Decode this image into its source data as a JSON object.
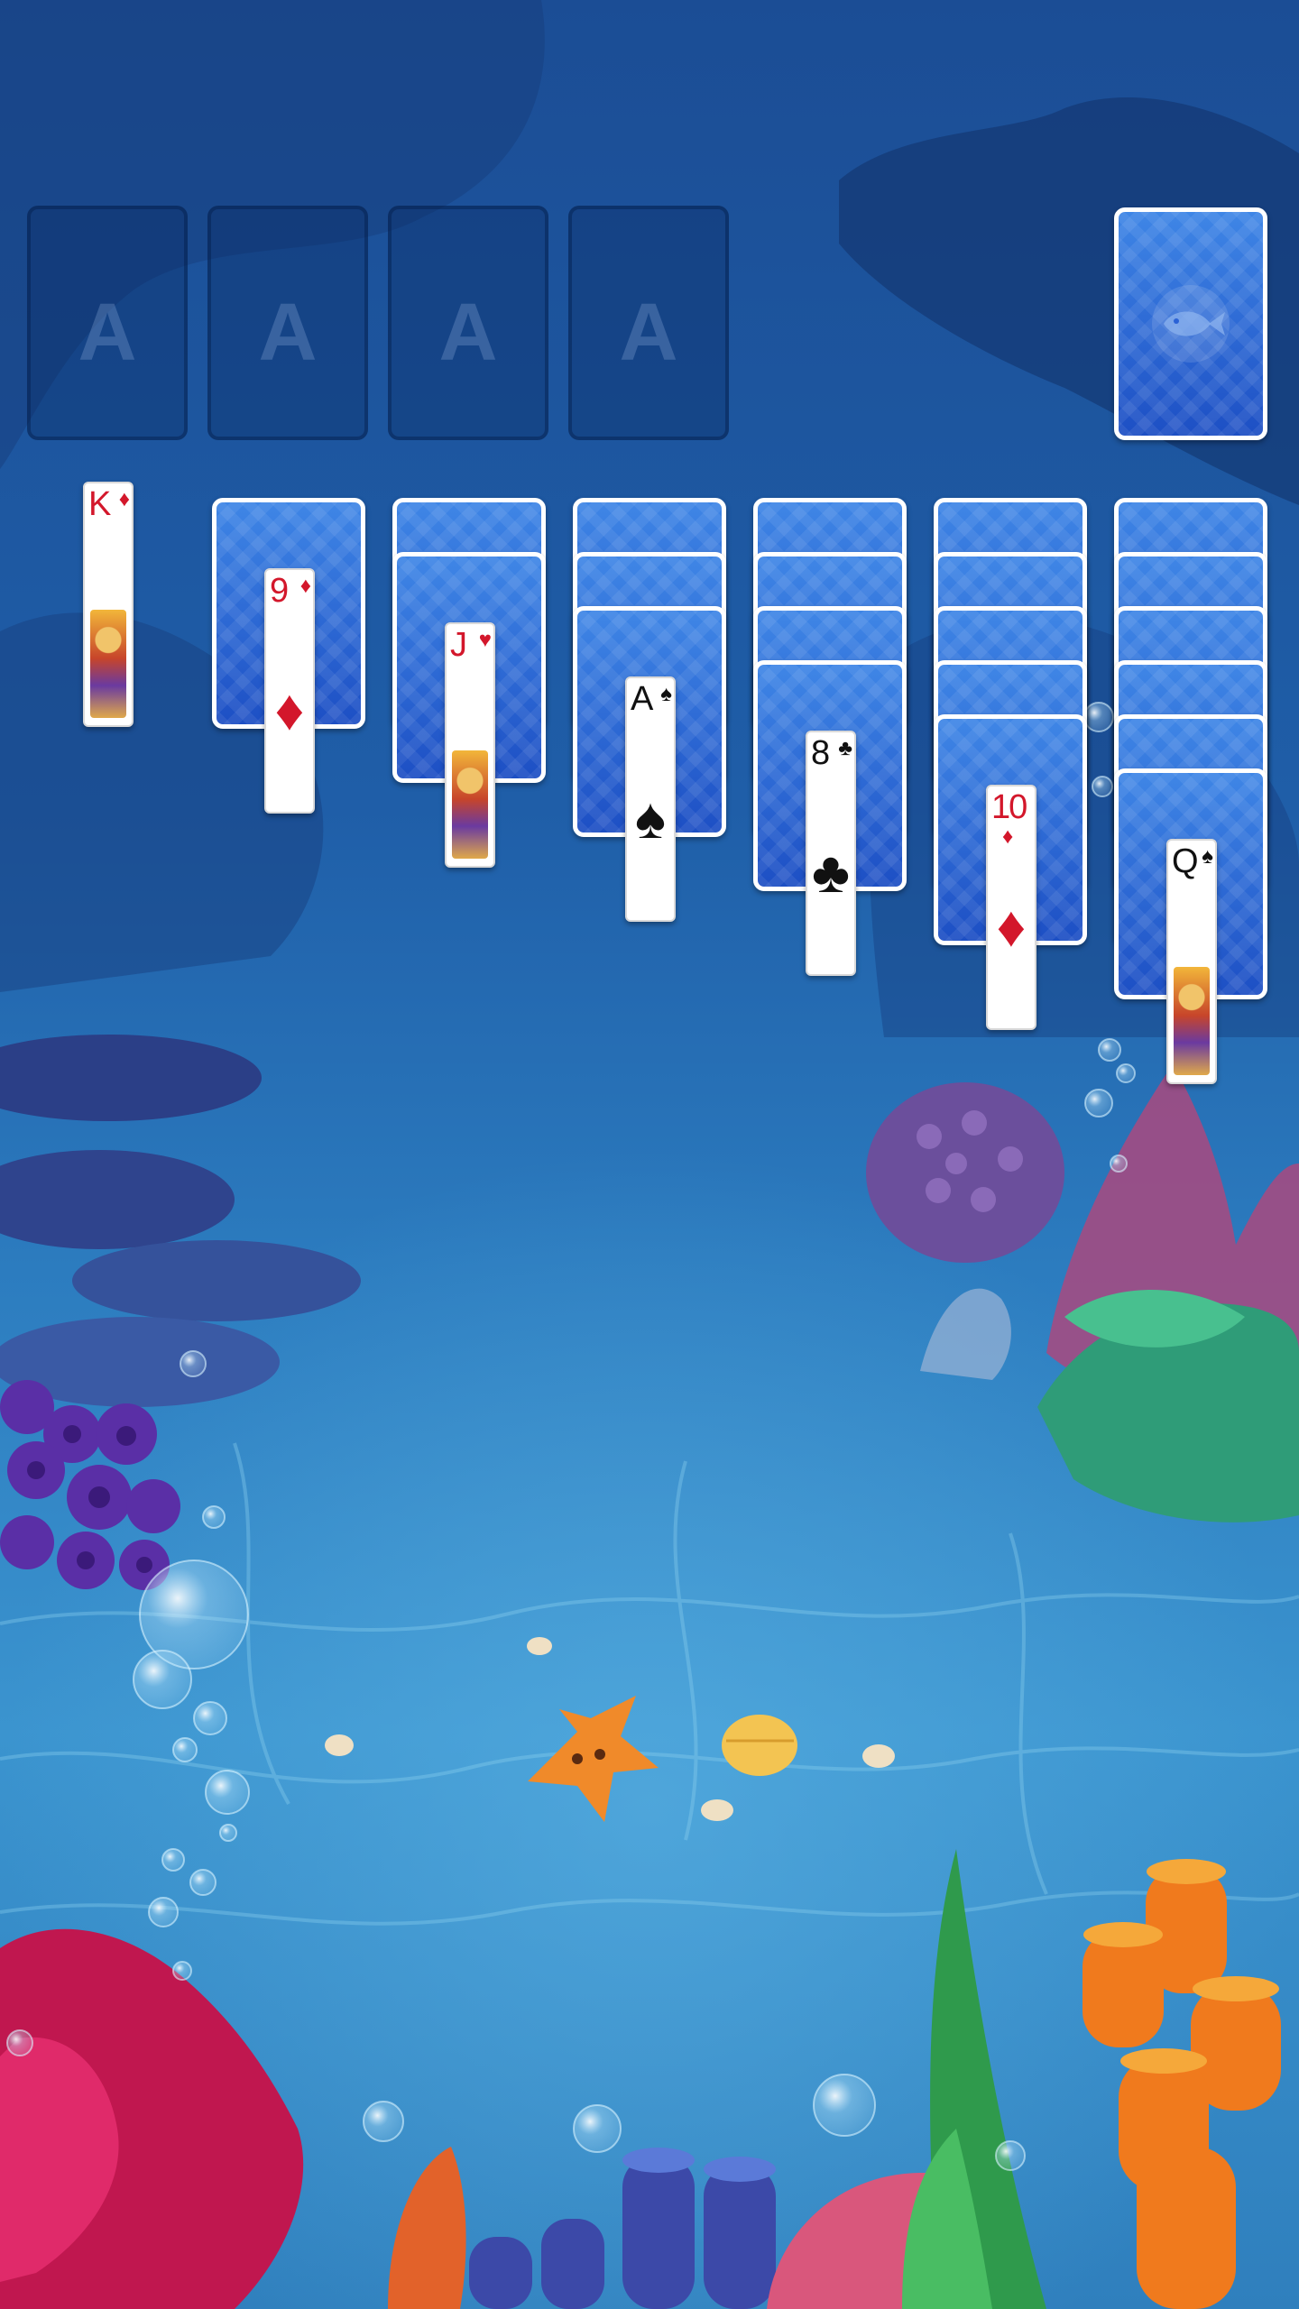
{
  "game": "Solitaire",
  "theme": "underwater",
  "colors": {
    "card_back": "#2a62d6",
    "red_suit": "#d3172b",
    "black_suit": "#111111"
  },
  "foundations": [
    {
      "label": "A"
    },
    {
      "label": "A"
    },
    {
      "label": "A"
    },
    {
      "label": "A"
    }
  ],
  "stock": {
    "icon": "fish-icon",
    "face_down": true
  },
  "tableau": [
    {
      "hidden": 0,
      "top": {
        "rank": "K",
        "suit": "♦",
        "color": "red",
        "court": true
      }
    },
    {
      "hidden": 1,
      "top": {
        "rank": "9",
        "suit": "♦",
        "color": "red",
        "court": false
      }
    },
    {
      "hidden": 2,
      "top": {
        "rank": "J",
        "suit": "♥",
        "color": "red",
        "court": true
      }
    },
    {
      "hidden": 3,
      "top": {
        "rank": "A",
        "suit": "♠",
        "color": "black",
        "court": false
      }
    },
    {
      "hidden": 4,
      "top": {
        "rank": "8",
        "suit": "♣",
        "color": "black",
        "court": false
      }
    },
    {
      "hidden": 5,
      "top": {
        "rank": "10",
        "suit": "♦",
        "color": "red",
        "court": false
      }
    },
    {
      "hidden": 6,
      "top": {
        "rank": "Q",
        "suit": "♠",
        "color": "black",
        "court": true
      }
    }
  ]
}
